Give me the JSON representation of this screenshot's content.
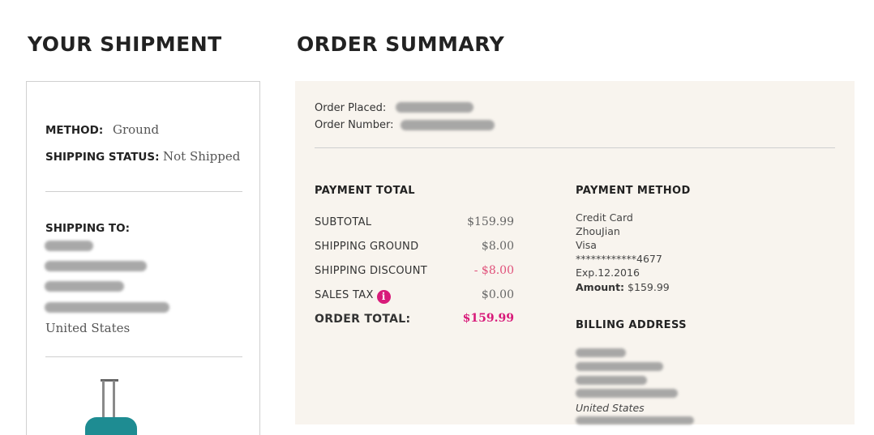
{
  "headings": {
    "shipment": "YOUR SHIPMENT",
    "summary": "ORDER SUMMARY"
  },
  "shipment": {
    "method_label": "METHOD:",
    "method_value": "Ground",
    "status_label": "SHIPPING STATUS:",
    "status_value": "Not Shipped",
    "shipping_to_label": "SHIPPING TO:",
    "country": "United States",
    "item_icon": "luggage-icon"
  },
  "order": {
    "placed_label": "Order Placed:",
    "number_label": "Order Number:"
  },
  "payment_total": {
    "title": "PAYMENT TOTAL",
    "rows": [
      {
        "label": "SUBTOTAL",
        "amount": "$159.99"
      },
      {
        "label": "SHIPPING GROUND",
        "amount": "$8.00"
      },
      {
        "label": "SHIPPING DISCOUNT",
        "amount": "- $8.00"
      },
      {
        "label": "SALES TAX",
        "amount": "$0.00"
      }
    ],
    "total_label": "ORDER TOTAL:",
    "total_amount": "$159.99",
    "info_icon_glyph": "i"
  },
  "payment_method": {
    "title": "PAYMENT METHOD",
    "type": "Credit Card",
    "name": "ZhouJian",
    "brand": "Visa",
    "card_number": "************4677",
    "expiry": "Exp.12.2016",
    "amount_label": "Amount:",
    "amount_value": "$159.99"
  },
  "billing": {
    "title": "BILLING ADDRESS",
    "country": "United States"
  },
  "colors": {
    "accent": "#d81b7a",
    "discount": "#e0507a",
    "panel_bg": "#f8f4ee",
    "luggage": "#1e8c92"
  }
}
